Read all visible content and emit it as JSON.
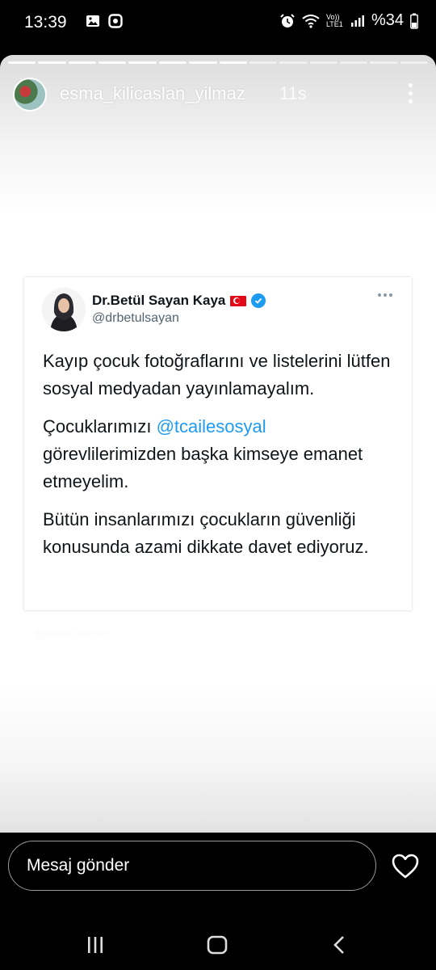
{
  "status_bar": {
    "time": "13:39",
    "network_label": "Vo)) LTE1",
    "battery_text": "%34"
  },
  "story": {
    "username": "esma_kilicaslan_yilmaz",
    "time_ago": "11s",
    "progress_segments_total": 14,
    "progress_segments_seen": 8
  },
  "tweet": {
    "author_name": "Dr.Betül Sayan Kaya",
    "handle": "@drbetulsayan",
    "paragraph1": "Kayıp çocuk fotoğraflarını ve listelerini lütfen sosyal medyadan yayınlamayalım.",
    "paragraph2_before": "Çocuklarımızı ",
    "paragraph2_mention": "@tcailesosyal",
    "paragraph2_after": " görevlilerimizden başka kimseye emanet etmeyelim.",
    "paragraph3": "Bütün insanlarımızı çocukların güvenliği konusunda azami dikkate davet ediyoruz."
  },
  "watermark": "@drbetulsayan",
  "composer": {
    "placeholder": "Mesaj gönder"
  },
  "colors": {
    "mention": "#1d9bf0",
    "verified": "#1d9bf0",
    "flag": "#e30a17"
  }
}
